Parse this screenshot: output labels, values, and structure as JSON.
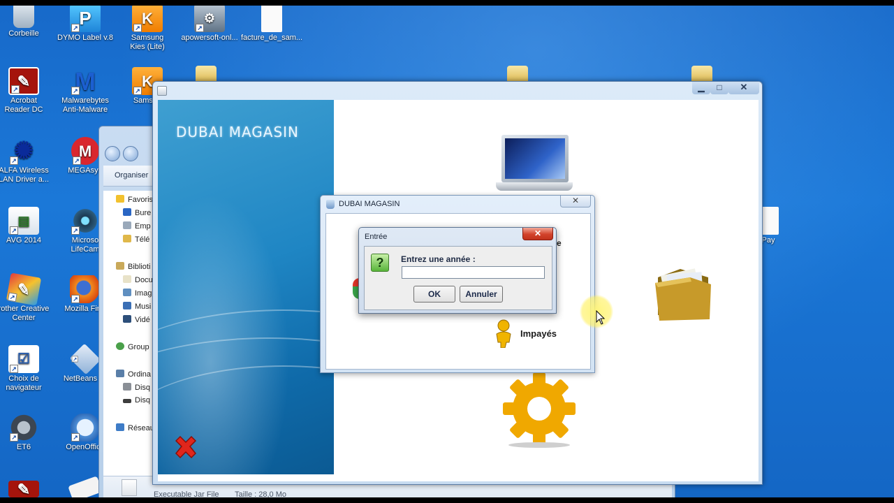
{
  "desktop": {
    "icons": [
      {
        "label": "Corbeille"
      },
      {
        "label": "Acrobat Reader DC"
      },
      {
        "label": "ALFA Wireless LAN Driver a..."
      },
      {
        "label": "AVG 2014"
      },
      {
        "label": "rother Creative Center"
      },
      {
        "label": "Choix de navigateur"
      },
      {
        "label": "ET6"
      },
      {
        "label": "DYMO Label v.8"
      },
      {
        "label": "Malwarebytes Anti-Malware"
      },
      {
        "label": "MEGAsyn"
      },
      {
        "label": "Microso LifeCam"
      },
      {
        "label": "Mozilla Firef"
      },
      {
        "label": "NetBeans ID"
      },
      {
        "label": "OpenOffice"
      },
      {
        "label": "Samsung Kies (Lite)"
      },
      {
        "label": "Samsun"
      },
      {
        "label": "apowersoft-onl..."
      },
      {
        "label": "facture_de_sam..."
      },
      {
        "label": "Pay"
      }
    ]
  },
  "explorer": {
    "organize_label": "Organiser",
    "nav": [
      "Favoris",
      "Bure",
      "Emp",
      "Télé",
      "Biblioti",
      "Docu",
      "Imag",
      "Musi",
      "Vidé",
      "Group",
      "Ordina",
      "Disq",
      "Disq",
      "Réseau"
    ],
    "status": {
      "type": "Executable Jar File",
      "size": "Taille : 28,0 Mo"
    }
  },
  "app": {
    "title": "DUBAI MAGASIN"
  },
  "dialog_main": {
    "title": "DUBAI MAGASIN",
    "partial_label": "e",
    "impayes_label": "Impayés"
  },
  "dialog_input": {
    "title": "Entrée",
    "prompt": "Entrez une année :",
    "value": "",
    "ok_label": "OK",
    "cancel_label": "Annuler"
  }
}
